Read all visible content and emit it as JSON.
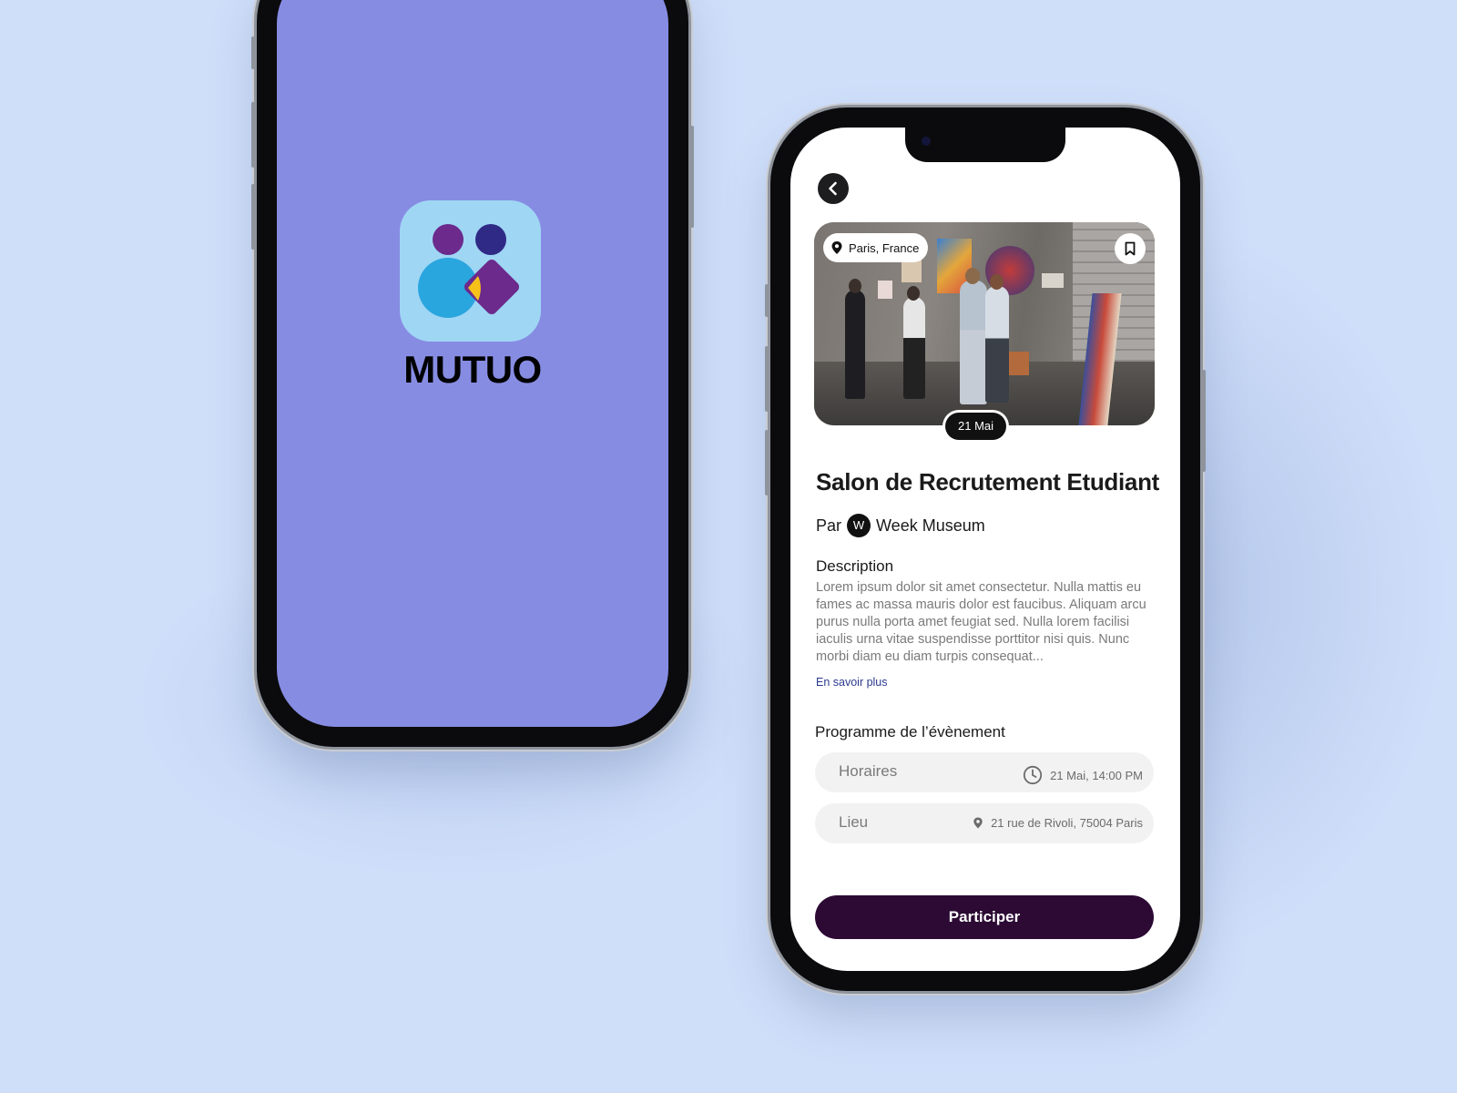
{
  "splash": {
    "app_name": "MUTUO",
    "colors": {
      "screen_bg": "#878ce3",
      "icon_bg": "#9fd6f4",
      "accent_purple": "#6b2a8c",
      "accent_blue": "#2aa6df",
      "accent_yellow": "#f6c21a"
    }
  },
  "event": {
    "back_icon": "chevron-left-icon",
    "location_badge": "Paris, France",
    "bookmark_icon": "bookmark-icon",
    "date_badge": "21 Mai",
    "title": "Salon de Recrutement Etudiant",
    "organizer": {
      "prefix": "Par",
      "avatar_letter": "W",
      "name": "Week Museum"
    },
    "description": {
      "heading": "Description",
      "text": "Lorem ipsum dolor sit amet consectetur. Nulla mattis eu fames ac massa mauris dolor est faucibus. Aliquam arcu purus nulla porta amet feugiat sed. Nulla lorem facilisi iaculis urna vitae suspendisse porttitor nisi quis. Nunc morbi diam eu diam turpis consequat...",
      "more_link": "En savoir plus"
    },
    "program": {
      "heading": "Programme de l’évènement",
      "rows": [
        {
          "label": "Horaires",
          "value": "21 Mai, 14:00 PM",
          "icon": "clock-icon"
        },
        {
          "label": "Lieu",
          "value": "21 rue de Rivoli, 75004 Paris",
          "icon": "map-pin-icon"
        }
      ]
    },
    "cta_label": "Participer",
    "colors": {
      "cta": "#2c0a34",
      "link": "#2c3a8e"
    }
  }
}
